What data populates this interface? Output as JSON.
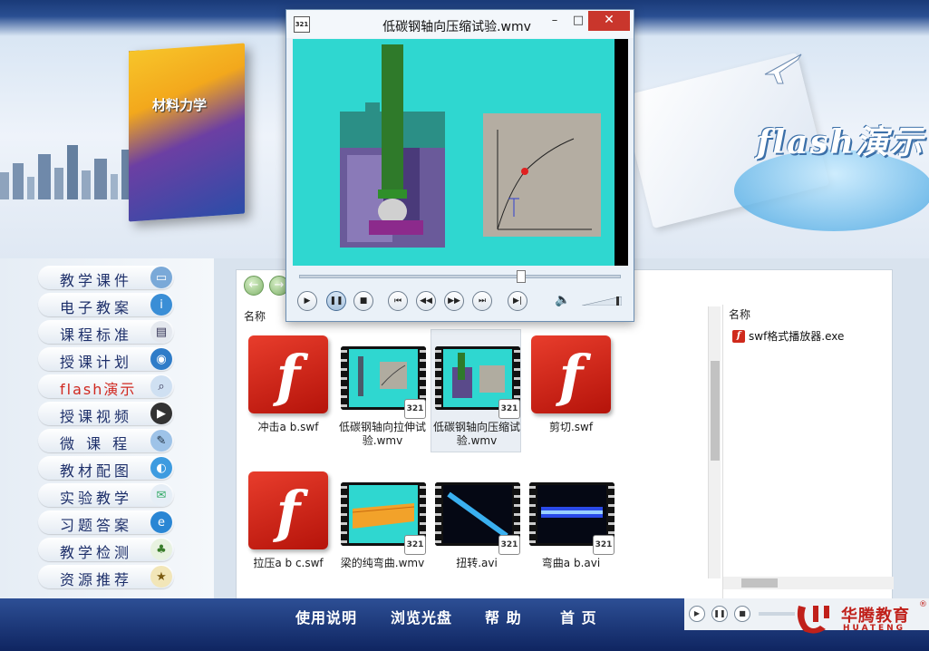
{
  "banner": {
    "book_title": "材料力学",
    "flash_title": "flash演示"
  },
  "sidebar": {
    "items": [
      {
        "label": "教学课件",
        "icon": "monitor-icon",
        "active": false
      },
      {
        "label": "电子教案",
        "icon": "info-icon",
        "active": false
      },
      {
        "label": "课程标准",
        "icon": "news-icon",
        "active": false
      },
      {
        "label": "授课计划",
        "icon": "globe-icon",
        "active": false
      },
      {
        "label": "flash演示",
        "icon": "magnifier-icon",
        "active": true
      },
      {
        "label": "授课视频",
        "icon": "film-icon",
        "active": false
      },
      {
        "label": "微 课 程",
        "icon": "pen-icon",
        "active": false
      },
      {
        "label": "教材配图",
        "icon": "image-icon",
        "active": false
      },
      {
        "label": "实验教学",
        "icon": "mail-icon",
        "active": false
      },
      {
        "label": "习题答案",
        "icon": "ie-icon",
        "active": false
      },
      {
        "label": "教学检测",
        "icon": "chart-icon",
        "active": false
      },
      {
        "label": "资源推荐",
        "icon": "recommend-icon",
        "active": false
      }
    ]
  },
  "explorer": {
    "column_name": "名称",
    "files": [
      {
        "label": "冲击a b.swf",
        "type": "flash"
      },
      {
        "label": "低碳钢轴向拉伸试验.wmv",
        "type": "video"
      },
      {
        "label": "低碳钢轴向压缩试验.wmv",
        "type": "video",
        "selected": true
      },
      {
        "label": "剪切.swf",
        "type": "flash"
      },
      {
        "label": "拉压a  b  c.swf",
        "type": "flash"
      },
      {
        "label": "梁的纯弯曲.wmv",
        "type": "video"
      },
      {
        "label": "扭转.avi",
        "type": "video"
      },
      {
        "label": "弯曲a  b.avi",
        "type": "video"
      }
    ],
    "right_pane": {
      "column_name": "名称",
      "file": "swf格式播放器.exe"
    }
  },
  "player": {
    "title": "低碳钢轴向压缩试验.wmv",
    "app_icon_text": "321",
    "minimize": "–",
    "maximize": "□",
    "close": "✕",
    "progress": 0.69,
    "volume": 0.9
  },
  "bottombar": {
    "links": [
      "使用说明",
      "浏览光盘",
      "帮  助",
      "首  页"
    ],
    "logo_cn": "华腾教育",
    "logo_en": "HUATENG",
    "registered": "®"
  },
  "colors": {
    "accent_blue": "#1d2f6a",
    "active_red": "#d0281f",
    "video_teal": "#2fd7d0",
    "flash_red": "#c8231a",
    "bottom_bar": "#12295f"
  }
}
